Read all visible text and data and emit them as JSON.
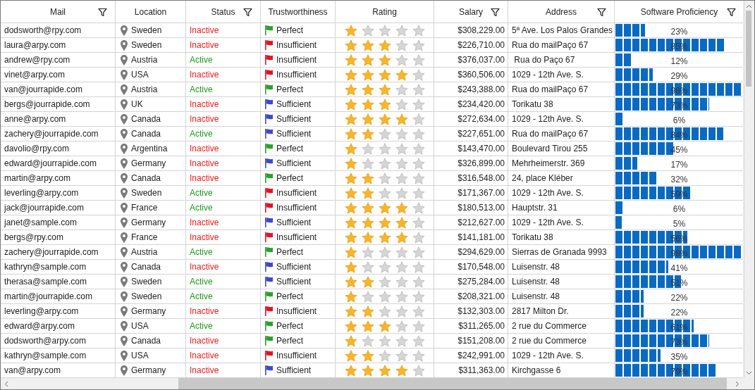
{
  "columns": [
    {
      "label": "Mail",
      "filter": true
    },
    {
      "label": "Location",
      "filter": false
    },
    {
      "label": "Status",
      "filter": true
    },
    {
      "label": "Trustworthiness",
      "filter": false
    },
    {
      "label": "Rating",
      "filter": false
    },
    {
      "label": "Salary",
      "filter": true
    },
    {
      "label": "Address",
      "filter": true
    },
    {
      "label": "Software Proficiency",
      "filter": true
    }
  ],
  "rows": [
    {
      "mail": "dodsworth@rpy.com",
      "location": "Sweden",
      "status": {
        "text": "Inactive",
        "active": false
      },
      "trust": {
        "text": "Perfect",
        "color": "#2ca02c"
      },
      "stars": 1,
      "salary": "$308,229.00",
      "address": "5ª Ave. Los Palos Grandes",
      "level": 0.23,
      "percent": "23%"
    },
    {
      "mail": "laura@arpy.com",
      "location": "Sweden",
      "status": {
        "text": "Inactive",
        "active": false
      },
      "trust": {
        "text": "Insufficient",
        "color": "#e81123"
      },
      "stars": 3,
      "salary": "$226,710.00",
      "address": "Rua do mailPaço 67",
      "level": 0.85,
      "percent": "85%"
    },
    {
      "mail": "andrew@rpy.com",
      "location": "Austria",
      "status": {
        "text": "Active",
        "active": true
      },
      "trust": {
        "text": "Insufficient",
        "color": "#e81123"
      },
      "stars": 3,
      "salary": "$376,037.00",
      "address": " Rua do Paço 67",
      "level": 0.12,
      "percent": "12%"
    },
    {
      "mail": "vinet@arpy.com",
      "location": "USA",
      "status": {
        "text": "Inactive",
        "active": false
      },
      "trust": {
        "text": "Insufficient",
        "color": "#e81123"
      },
      "stars": 4,
      "salary": "$360,506.00",
      "address": "1029 - 12th Ave. S.",
      "level": 0.29,
      "percent": "29%"
    },
    {
      "mail": "van@jourrapide.com",
      "location": "Austria",
      "status": {
        "text": "Active",
        "active": true
      },
      "trust": {
        "text": "Perfect",
        "color": "#2ca02c"
      },
      "stars": 3,
      "salary": "$243,388.00",
      "address": "Rua do mailPaço 67",
      "level": 0.98,
      "percent": "98%"
    },
    {
      "mail": "bergs@jourrapide.com",
      "location": "UK",
      "status": {
        "text": "Inactive",
        "active": false
      },
      "trust": {
        "text": "Sufficient",
        "color": "#3f48cc"
      },
      "stars": 3,
      "salary": "$234,420.00",
      "address": "Torikatu 38",
      "level": 0.73,
      "percent": "73%"
    },
    {
      "mail": "anne@arpy.com",
      "location": "Canada",
      "status": {
        "text": "Inactive",
        "active": false
      },
      "trust": {
        "text": "Sufficient",
        "color": "#3f48cc"
      },
      "stars": 4,
      "salary": "$272,634.00",
      "address": "1029 - 12th Ave. S.",
      "level": 0.06,
      "percent": "6%"
    },
    {
      "mail": "zachery@jourrapide.com",
      "location": "Canada",
      "status": {
        "text": "Active",
        "active": true
      },
      "trust": {
        "text": "Sufficient",
        "color": "#3f48cc"
      },
      "stars": 2,
      "salary": "$227,651.00",
      "address": "Rua do mailPaço 67",
      "level": 0.84,
      "percent": "84%"
    },
    {
      "mail": "davolio@rpy.com",
      "location": "Argentina",
      "status": {
        "text": "Inactive",
        "active": false
      },
      "trust": {
        "text": "Perfect",
        "color": "#2ca02c"
      },
      "stars": 1,
      "salary": "$143,470.00",
      "address": "Boulevard Tirou 255",
      "level": 0.45,
      "percent": "45%"
    },
    {
      "mail": "edward@jourrapide.com",
      "location": "Germany",
      "status": {
        "text": "Inactive",
        "active": false
      },
      "trust": {
        "text": "Sufficient",
        "color": "#3f48cc"
      },
      "stars": 1,
      "salary": "$326,899.00",
      "address": "Mehrheimerstr. 369",
      "level": 0.17,
      "percent": "17%"
    },
    {
      "mail": "martin@arpy.com",
      "location": "Canada",
      "status": {
        "text": "Inactive",
        "active": false
      },
      "trust": {
        "text": "Perfect",
        "color": "#2ca02c"
      },
      "stars": 2,
      "salary": "$316,548.00",
      "address": "24, place Kléber",
      "level": 0.32,
      "percent": "32%"
    },
    {
      "mail": "leverling@arpy.com",
      "location": "Sweden",
      "status": {
        "text": "Active",
        "active": true
      },
      "trust": {
        "text": "Insufficient",
        "color": "#e81123"
      },
      "stars": 2,
      "salary": "$171,367.00",
      "address": "1029 - 12th Ave. S.",
      "level": 0.59,
      "percent": "59%"
    },
    {
      "mail": "jack@jourrapide.com",
      "location": "France",
      "status": {
        "text": "Active",
        "active": true
      },
      "trust": {
        "text": "Insufficient",
        "color": "#e81123"
      },
      "stars": 4,
      "salary": "$180,513.00",
      "address": "Hauptstr. 31",
      "level": 0.06,
      "percent": "6%"
    },
    {
      "mail": "janet@sample.com",
      "location": "Germany",
      "status": {
        "text": "Inactive",
        "active": false
      },
      "trust": {
        "text": "Sufficient",
        "color": "#3f48cc"
      },
      "stars": 4,
      "salary": "$212,627.00",
      "address": "1029 - 12th Ave. S.",
      "level": 0.05,
      "percent": "5%"
    },
    {
      "mail": "bergs@rpy.com",
      "location": "France",
      "status": {
        "text": "Inactive",
        "active": false
      },
      "trust": {
        "text": "Insufficient",
        "color": "#e81123"
      },
      "stars": 4,
      "salary": "$141,181.00",
      "address": "Torikatu 38",
      "level": 0.56,
      "percent": "56%"
    },
    {
      "mail": "zachery@jourrapide.com",
      "location": "Austria",
      "status": {
        "text": "Active",
        "active": true
      },
      "trust": {
        "text": "Perfect",
        "color": "#2ca02c"
      },
      "stars": 1,
      "salary": "$294,629.00",
      "address": "Sierras de Granada 9993",
      "level": 0.98,
      "percent": "98%"
    },
    {
      "mail": "kathryn@sample.com",
      "location": "Canada",
      "status": {
        "text": "Inactive",
        "active": false
      },
      "trust": {
        "text": "Sufficient",
        "color": "#3f48cc"
      },
      "stars": 1,
      "salary": "$170,548.00",
      "address": "Luisenstr. 48",
      "level": 0.41,
      "percent": "41%"
    },
    {
      "mail": "therasa@sample.com",
      "location": "Sweden",
      "status": {
        "text": "Active",
        "active": true
      },
      "trust": {
        "text": "Sufficient",
        "color": "#3f48cc"
      },
      "stars": 2,
      "salary": "$275,284.00",
      "address": "Luisenstr. 48",
      "level": 0.51,
      "percent": "51%"
    },
    {
      "mail": "martin@jourrapide.com",
      "location": "Sweden",
      "status": {
        "text": "Active",
        "active": true
      },
      "trust": {
        "text": "Perfect",
        "color": "#2ca02c"
      },
      "stars": 1,
      "salary": "$208,321.00",
      "address": "Luisenstr. 48",
      "level": 0.22,
      "percent": "22%"
    },
    {
      "mail": "leverling@arpy.com",
      "location": "Germany",
      "status": {
        "text": "Inactive",
        "active": false
      },
      "trust": {
        "text": "Insufficient",
        "color": "#e81123"
      },
      "stars": 2,
      "salary": "$132,303.00",
      "address": "2817 Milton Dr.",
      "level": 0.22,
      "percent": "22%"
    },
    {
      "mail": "edward@arpy.com",
      "location": "USA",
      "status": {
        "text": "Active",
        "active": true
      },
      "trust": {
        "text": "Perfect",
        "color": "#2ca02c"
      },
      "stars": 3,
      "salary": "$311,265.00",
      "address": "2 rue du Commerce",
      "level": 0.61,
      "percent": "61%"
    },
    {
      "mail": "dodsworth@arpy.com",
      "location": "Canada",
      "status": {
        "text": "Inactive",
        "active": false
      },
      "trust": {
        "text": "Perfect",
        "color": "#2ca02c"
      },
      "stars": 1,
      "salary": "$151,208.00",
      "address": "2 rue du Commerce",
      "level": 0.73,
      "percent": "73%"
    },
    {
      "mail": "kathryn@sample.com",
      "location": "USA",
      "status": {
        "text": "Inactive",
        "active": false
      },
      "trust": {
        "text": "Insufficient",
        "color": "#e81123"
      },
      "stars": 2,
      "salary": "$242,991.00",
      "address": "1029 - 12th Ave. S.",
      "level": 0.35,
      "percent": "35%"
    },
    {
      "mail": "van@arpy.com",
      "location": "Germany",
      "status": {
        "text": "Inactive",
        "active": false
      },
      "trust": {
        "text": "Sufficient",
        "color": "#3f48cc"
      },
      "stars": 4,
      "salary": "$311,363.00",
      "address": "Kirchgasse 6",
      "level": 0.79,
      "percent": "79%"
    }
  ]
}
